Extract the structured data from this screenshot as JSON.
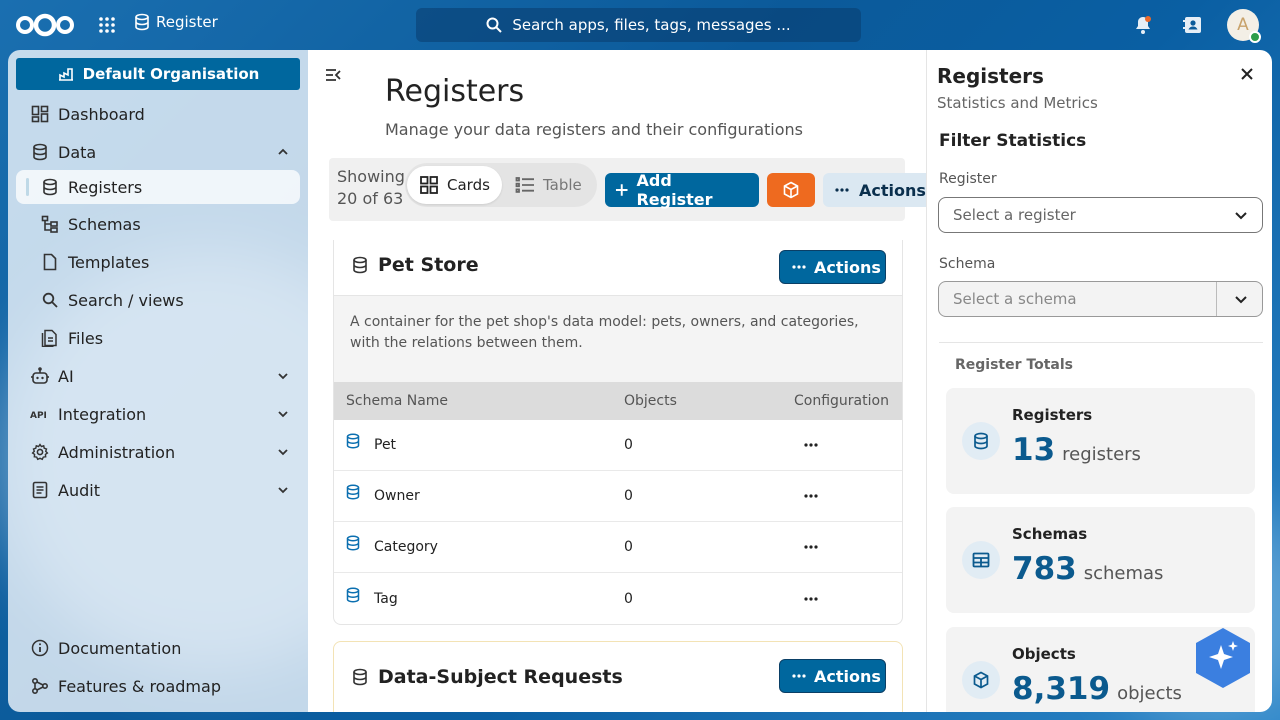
{
  "topbar": {
    "app_name": "Register",
    "search_placeholder": "Search apps, files, tags, messages ...",
    "avatar_initial": "A"
  },
  "sidebar": {
    "org_button": "Default Organisation",
    "items": [
      {
        "label": "Dashboard"
      },
      {
        "label": "Data"
      },
      {
        "label": "Registers"
      },
      {
        "label": "Schemas"
      },
      {
        "label": "Templates"
      },
      {
        "label": "Search / views"
      },
      {
        "label": "Files"
      },
      {
        "label": "AI"
      },
      {
        "label": "Integration"
      },
      {
        "label": "Administration"
      },
      {
        "label": "Audit"
      }
    ],
    "footer": [
      {
        "label": "Documentation"
      },
      {
        "label": "Features & roadmap"
      }
    ]
  },
  "main": {
    "title": "Registers",
    "subtitle": "Manage your data registers and their configurations",
    "toolbar": {
      "showing_line1": "Showing",
      "showing_line2": "20 of 63",
      "cards_label": "Cards",
      "table_label": "Table",
      "add_label": "Add Register",
      "actions_label": "Actions"
    },
    "cards": [
      {
        "title": "Pet Store",
        "actions_label": "Actions",
        "description": "A container for the pet shop's data model: pets, owners, and categories, with the relations between them.",
        "columns": [
          "Schema Name",
          "Objects",
          "Configuration"
        ],
        "rows": [
          {
            "name": "Pet",
            "objects": "0"
          },
          {
            "name": "Owner",
            "objects": "0"
          },
          {
            "name": "Category",
            "objects": "0"
          },
          {
            "name": "Tag",
            "objects": "0"
          }
        ]
      },
      {
        "title": "Data-Subject Requests",
        "actions_label": "Actions"
      }
    ]
  },
  "panel": {
    "title": "Registers",
    "subtitle": "Statistics and Metrics",
    "filter_heading": "Filter Statistics",
    "register_label": "Register",
    "register_placeholder": "Select a register",
    "schema_label": "Schema",
    "schema_placeholder": "Select a schema",
    "totals_heading": "Register Totals",
    "stats": [
      {
        "label": "Registers",
        "value": "13",
        "unit": "registers"
      },
      {
        "label": "Schemas",
        "value": "783",
        "unit": "schemas"
      },
      {
        "label": "Objects",
        "value": "8,319",
        "unit": "objects"
      }
    ]
  },
  "colors": {
    "primary": "#00679e",
    "accent_orange": "#ee6a1f"
  }
}
